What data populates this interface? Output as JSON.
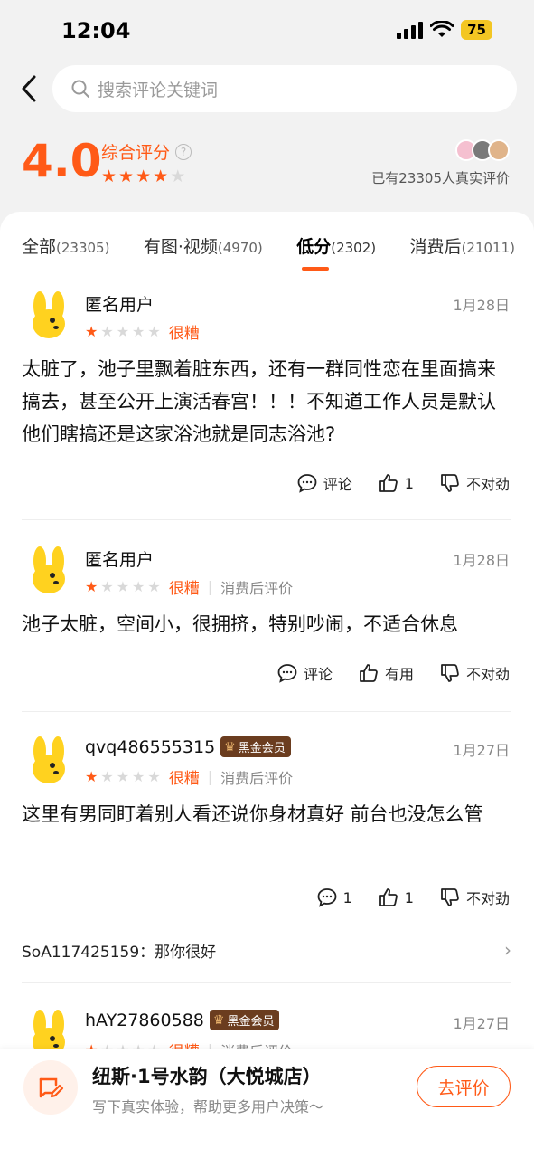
{
  "status": {
    "time": "12:04",
    "battery": "75"
  },
  "search": {
    "placeholder": "搜索评论关键词"
  },
  "summary": {
    "score": "4.0",
    "label": "综合评分",
    "stars": 4,
    "review_count_text": "已有23305人真实评价",
    "colors": {
      "accent": "#ff5a17"
    }
  },
  "tabs": [
    {
      "label": "全部",
      "count": "(23305)",
      "active": false
    },
    {
      "label": "有图·视频",
      "count": "(4970)",
      "active": false
    },
    {
      "label": "低分",
      "count": "(2302)",
      "active": true
    },
    {
      "label": "消费后",
      "count": "(21011)",
      "active": false
    }
  ],
  "reviews": [
    {
      "user": "匿名用户",
      "badge": "",
      "date": "1月28日",
      "stars": 1,
      "rating_word": "很糟",
      "tag": "",
      "text": "太脏了，池子里飘着脏东西，还有一群同性恋在里面搞来搞去，甚至公开上演活春宫！！！不知道工作人员是默认他们瞎搞还是这家浴池就是同志浴池?",
      "comment_label": "评论",
      "like_label": "1",
      "dislike_label": "不对劲"
    },
    {
      "user": "匿名用户",
      "badge": "",
      "date": "1月28日",
      "stars": 1,
      "rating_word": "很糟",
      "tag": "消费后评价",
      "text": "池子太脏，空间小，很拥挤，特别吵闹，不适合休息",
      "comment_label": "评论",
      "like_label": "有用",
      "dislike_label": "不对劲"
    },
    {
      "user": "qvq486555315",
      "badge": "黑金会员",
      "date": "1月27日",
      "stars": 1,
      "rating_word": "很糟",
      "tag": "消费后评价",
      "text": "这里有男同盯着别人看还说你身材真好 前台也没怎么管",
      "comment_label": "1",
      "like_label": "1",
      "dislike_label": "不对劲",
      "reply": "SoA117425159：那你很好"
    },
    {
      "user": "hAY27860588",
      "badge": "黑金会员",
      "date": "1月27日",
      "stars": 1,
      "rating_word": "很糟",
      "tag": "消费后评价"
    }
  ],
  "bottom": {
    "shop_name": "纽斯·1号水韵（大悦城店）",
    "subtitle": "写下真实体验，帮助更多用户决策～",
    "button": "去评价"
  }
}
